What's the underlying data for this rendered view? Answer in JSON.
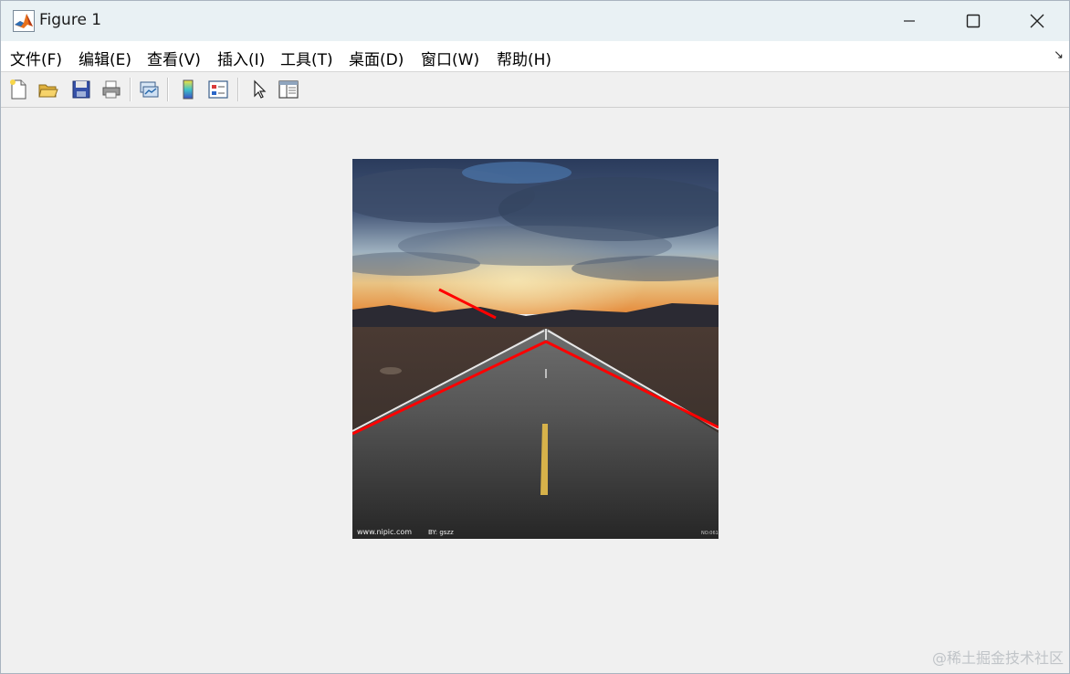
{
  "window": {
    "title": "Figure 1",
    "icons": {
      "app": "matlab-logo-icon",
      "minimize": "minimize-icon",
      "maximize": "maximize-icon",
      "close": "close-icon"
    }
  },
  "menubar": {
    "items": [
      {
        "label": "文件(F)"
      },
      {
        "label": "编辑(E)"
      },
      {
        "label": "查看(V)"
      },
      {
        "label": "插入(I)"
      },
      {
        "label": "工具(T)"
      },
      {
        "label": "桌面(D)"
      },
      {
        "label": "窗口(W)"
      },
      {
        "label": "帮助(H)"
      }
    ],
    "dock_icon": "dock-arrow-icon",
    "dock_glyph": "↘"
  },
  "toolbar": {
    "buttons": [
      {
        "icon": "new-figure-icon"
      },
      {
        "icon": "open-file-icon"
      },
      {
        "icon": "save-icon"
      },
      {
        "icon": "print-icon"
      },
      {
        "icon": "link-plot-icon"
      },
      {
        "icon": "insert-colorbar-icon"
      },
      {
        "icon": "insert-legend-icon"
      },
      {
        "icon": "edit-plot-pointer-icon"
      },
      {
        "icon": "property-inspector-icon"
      }
    ]
  },
  "figure": {
    "image_description_icon": "road-sunset-photo",
    "image_caption_left": "www.nipic.com",
    "image_caption_mid": "BY: gszz",
    "image_caption_right": "NO:061",
    "line_color": "#ff0000"
  },
  "watermark": "@稀土掘金技术社区"
}
